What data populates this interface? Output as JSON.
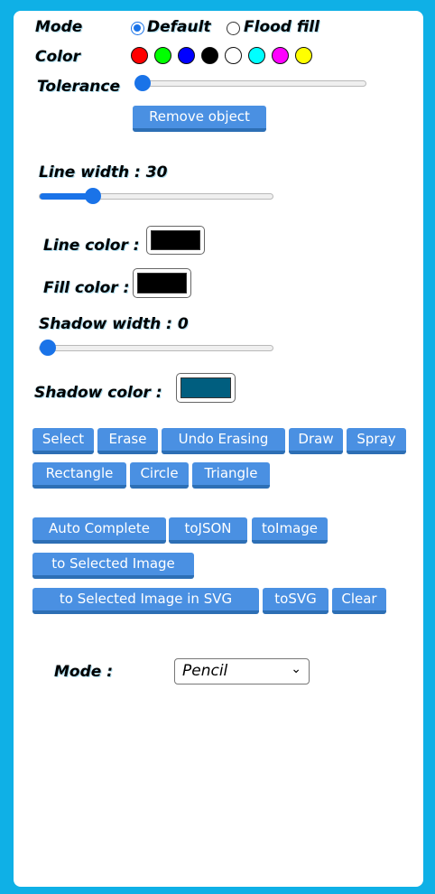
{
  "top": {
    "mode_label": "Mode",
    "mode_options": [
      "Default",
      "Flood fill"
    ],
    "mode_selected": "Default",
    "color_label": "Color",
    "colors": [
      "#ff0000",
      "#00ff00",
      "#0000ff",
      "#000000",
      "#ffffff",
      "#00ffff",
      "#ff00ff",
      "#ffff00"
    ],
    "tolerance_label": "Tolerance",
    "tolerance_value": 0,
    "remove_button": "Remove object"
  },
  "brush": {
    "line_width_label": "Line width : 30",
    "line_width_fraction": 0.23,
    "line_color_label": "Line color :",
    "line_color": "#000000",
    "fill_color_label": "Fill color :",
    "fill_color": "#000000",
    "shadow_width_label": "Shadow width : 0",
    "shadow_width_fraction": 0,
    "shadow_color_label": "Shadow color :",
    "shadow_color": "#005e7f"
  },
  "tools": {
    "select": "Select",
    "erase": "Erase",
    "undo_erasing": "Undo Erasing",
    "draw": "Draw",
    "spray": "Spray",
    "rectangle": "Rectangle",
    "circle": "Circle",
    "triangle": "Triangle"
  },
  "actions": {
    "auto_complete": "Auto Complete",
    "to_json": "toJSON",
    "to_image": "toImage",
    "to_selected_image": "to Selected Image",
    "to_selected_image_svg": "to Selected Image in SVG",
    "to_svg": "toSVG",
    "clear": "Clear"
  },
  "drawing_mode": {
    "label": "Mode :",
    "selected": "Pencil"
  },
  "theme": {
    "accent": "#1a73e8",
    "button": "#4a90e2",
    "frame": "#0fb0e6"
  }
}
